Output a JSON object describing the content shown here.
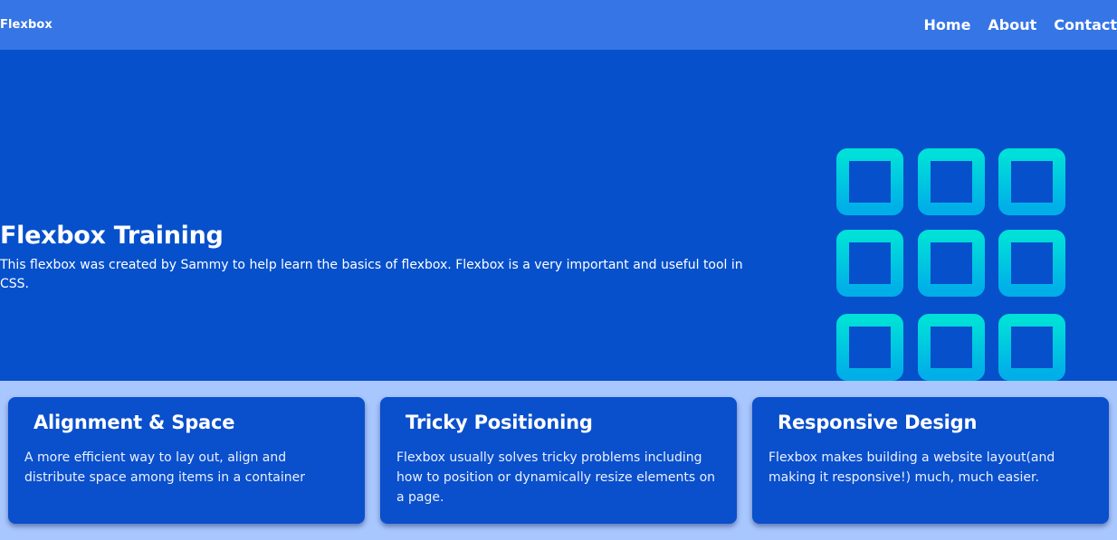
{
  "navbar": {
    "brand": "Flexbox",
    "links": [
      "Home",
      "About",
      "Contact"
    ]
  },
  "hero": {
    "title": "Flexbox Training",
    "description": "This flexbox was created by Sammy to help learn the basics of flexbox. Flexbox is a very important and useful tool in CSS.",
    "graphic_icon": "grid-icon"
  },
  "cards": [
    {
      "title": "Alignment & Space",
      "text": "A more efficient way to lay out, align and distribute space among items in a container"
    },
    {
      "title": "Tricky Positioning",
      "text": "Flexbox usually solves tricky problems including how to position or dynamically resize elements on a page."
    },
    {
      "title": "Responsive Design",
      "text": "Flexbox makes building a website layout(and making it responsive!) much, much easier."
    }
  ],
  "colors": {
    "navbar": "#3675e6",
    "hero": "#0650cb",
    "page_background": "#a9c7ff",
    "card": "#0a4fcc",
    "grid_gradient_top": "#00e0d8",
    "grid_gradient_bottom": "#00aee8"
  }
}
